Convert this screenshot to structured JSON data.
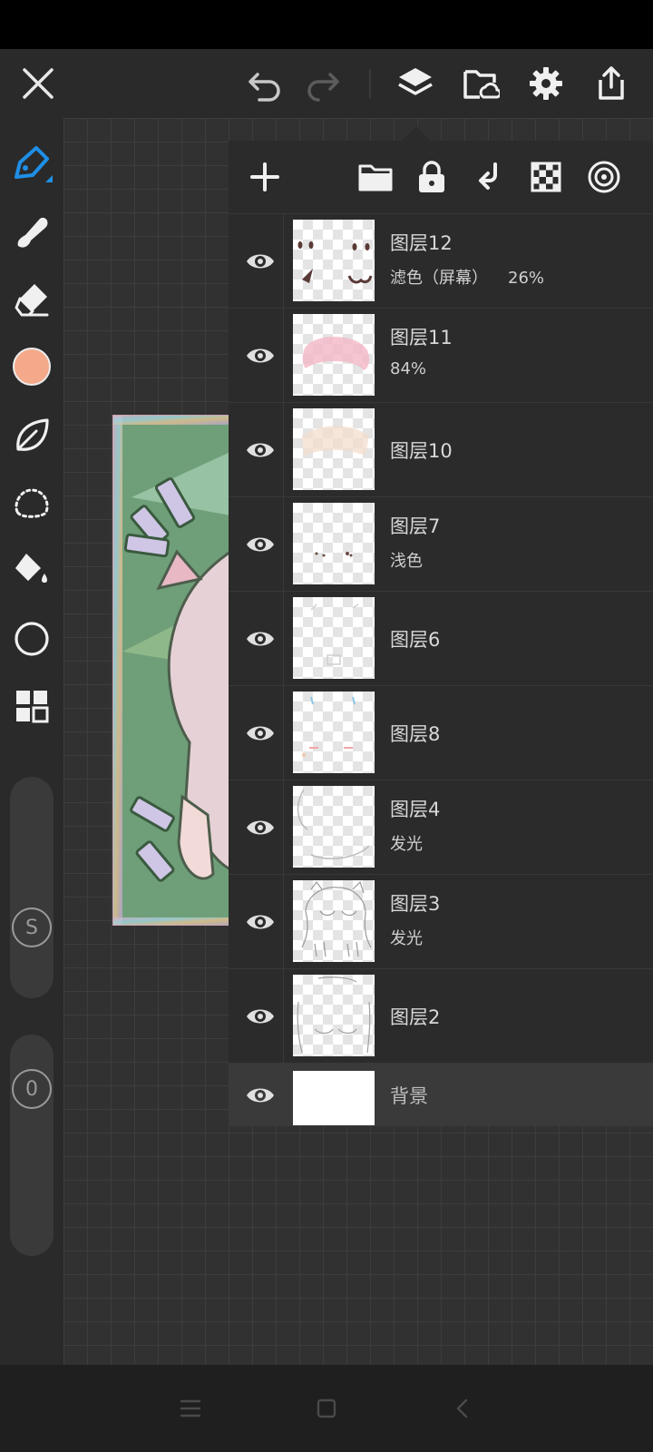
{
  "top_toolbar": {
    "icons": [
      "close-icon",
      "undo-icon",
      "redo-icon",
      "layers-icon",
      "cloud-folder-icon",
      "settings-icon",
      "share-icon"
    ]
  },
  "left_toolbar": {
    "tools": [
      "pen-icon",
      "smudge-icon",
      "eraser-icon",
      "color-swatch",
      "leaf-icon",
      "lasso-icon",
      "fill-bucket-icon",
      "shape-circle-icon",
      "grid-apps-icon"
    ],
    "active_tool": "pen",
    "active_color": "#f4a98a",
    "size_slider_label": "S",
    "opacity_slider_label": "0"
  },
  "layers_panel": {
    "header_icons": [
      "add-layer-icon",
      "folder-icon",
      "lock-icon",
      "merge-down-icon",
      "transparency-checker-icon",
      "target-icon"
    ],
    "layers": [
      {
        "name": "图层12",
        "blend": "滤色（屏幕）",
        "opacity": "26%"
      },
      {
        "name": "图层11",
        "blend": "",
        "opacity": "84%"
      },
      {
        "name": "图层10",
        "blend": "",
        "opacity": ""
      },
      {
        "name": "图层7",
        "blend": "浅色",
        "opacity": ""
      },
      {
        "name": "图层6",
        "blend": "",
        "opacity": ""
      },
      {
        "name": "图层8",
        "blend": "",
        "opacity": ""
      },
      {
        "name": "图层4",
        "blend": "发光",
        "opacity": ""
      },
      {
        "name": "图层3",
        "blend": "发光",
        "opacity": ""
      },
      {
        "name": "图层2",
        "blend": "",
        "opacity": ""
      },
      {
        "name": "背景",
        "blend": "",
        "opacity": "",
        "selected": true
      }
    ]
  },
  "nav_bar": {
    "icons": [
      "menu-icon",
      "home-icon",
      "back-icon"
    ]
  }
}
